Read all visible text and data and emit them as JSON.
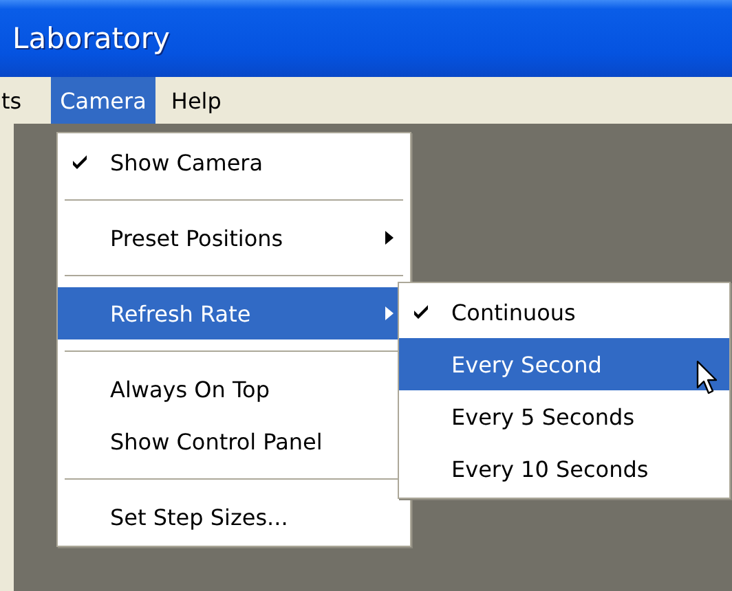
{
  "window": {
    "title": "Laboratory"
  },
  "menu_bar": [
    {
      "label": "ts",
      "selected": false
    },
    {
      "label": "Camera",
      "selected": true
    },
    {
      "label": "Help",
      "selected": false
    }
  ],
  "camera_menu": [
    {
      "kind": "item",
      "label": "Show Camera",
      "checked": true,
      "submenu": false,
      "selected": false
    },
    {
      "kind": "separator"
    },
    {
      "kind": "item",
      "label": "Preset Positions",
      "checked": false,
      "submenu": true,
      "selected": false
    },
    {
      "kind": "separator"
    },
    {
      "kind": "item",
      "label": "Refresh Rate",
      "checked": false,
      "submenu": true,
      "selected": true
    },
    {
      "kind": "separator"
    },
    {
      "kind": "item",
      "label": "Always On Top",
      "checked": false,
      "submenu": false,
      "selected": false
    },
    {
      "kind": "item",
      "label": "Show Control Panel",
      "checked": false,
      "submenu": false,
      "selected": false
    },
    {
      "kind": "separator"
    },
    {
      "kind": "item",
      "label": "Set Step Sizes...",
      "checked": false,
      "submenu": false,
      "selected": false
    }
  ],
  "refresh_rate_menu": [
    {
      "label": "Continuous",
      "checked": true,
      "selected": false
    },
    {
      "label": "Every Second",
      "checked": false,
      "selected": true
    },
    {
      "label": "Every 5 Seconds",
      "checked": false,
      "selected": false
    },
    {
      "label": "Every 10 Seconds",
      "checked": false,
      "selected": false
    }
  ]
}
